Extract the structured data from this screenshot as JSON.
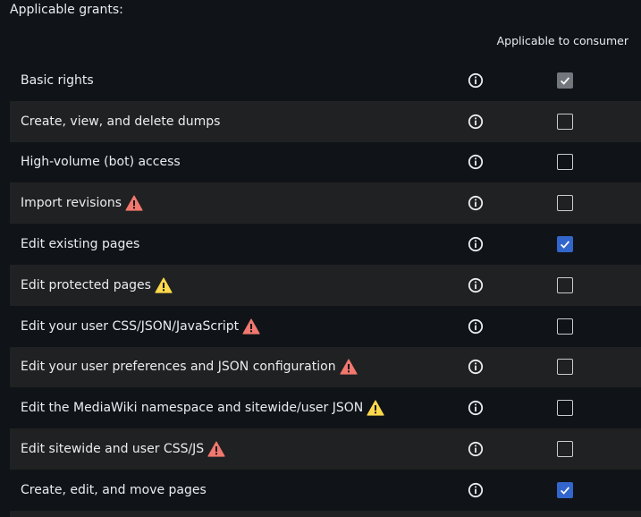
{
  "section_title": "Applicable grants:",
  "column_header": "Applicable to consumer",
  "colors": {
    "background": "#101418",
    "stripe": "#202122",
    "checkbox_checked": "#3366cc",
    "checkbox_disabled": "#72777d",
    "warning_red": "#f0786e",
    "warning_yellow": "#fdd94d"
  },
  "grants": [
    {
      "label": "Basic rights",
      "warning": "none",
      "state": "checked-disabled"
    },
    {
      "label": "Create, view, and delete dumps",
      "warning": "none",
      "state": "unchecked"
    },
    {
      "label": "High-volume (bot) access",
      "warning": "none",
      "state": "unchecked"
    },
    {
      "label": "Import revisions",
      "warning": "red",
      "state": "unchecked"
    },
    {
      "label": "Edit existing pages",
      "warning": "none",
      "state": "checked"
    },
    {
      "label": "Edit protected pages",
      "warning": "yellow",
      "state": "unchecked"
    },
    {
      "label": "Edit your user CSS/JSON/JavaScript",
      "warning": "red",
      "state": "unchecked"
    },
    {
      "label": "Edit your user preferences and JSON configuration",
      "warning": "red",
      "state": "unchecked"
    },
    {
      "label": "Edit the MediaWiki namespace and sitewide/user JSON",
      "warning": "yellow",
      "state": "unchecked"
    },
    {
      "label": "Edit sitewide and user CSS/JS",
      "warning": "red",
      "state": "unchecked"
    },
    {
      "label": "Create, edit, and move pages",
      "warning": "none",
      "state": "checked"
    }
  ],
  "icons": {
    "info": "info-icon",
    "warning": "warning-icon",
    "check": "checkmark-icon"
  }
}
